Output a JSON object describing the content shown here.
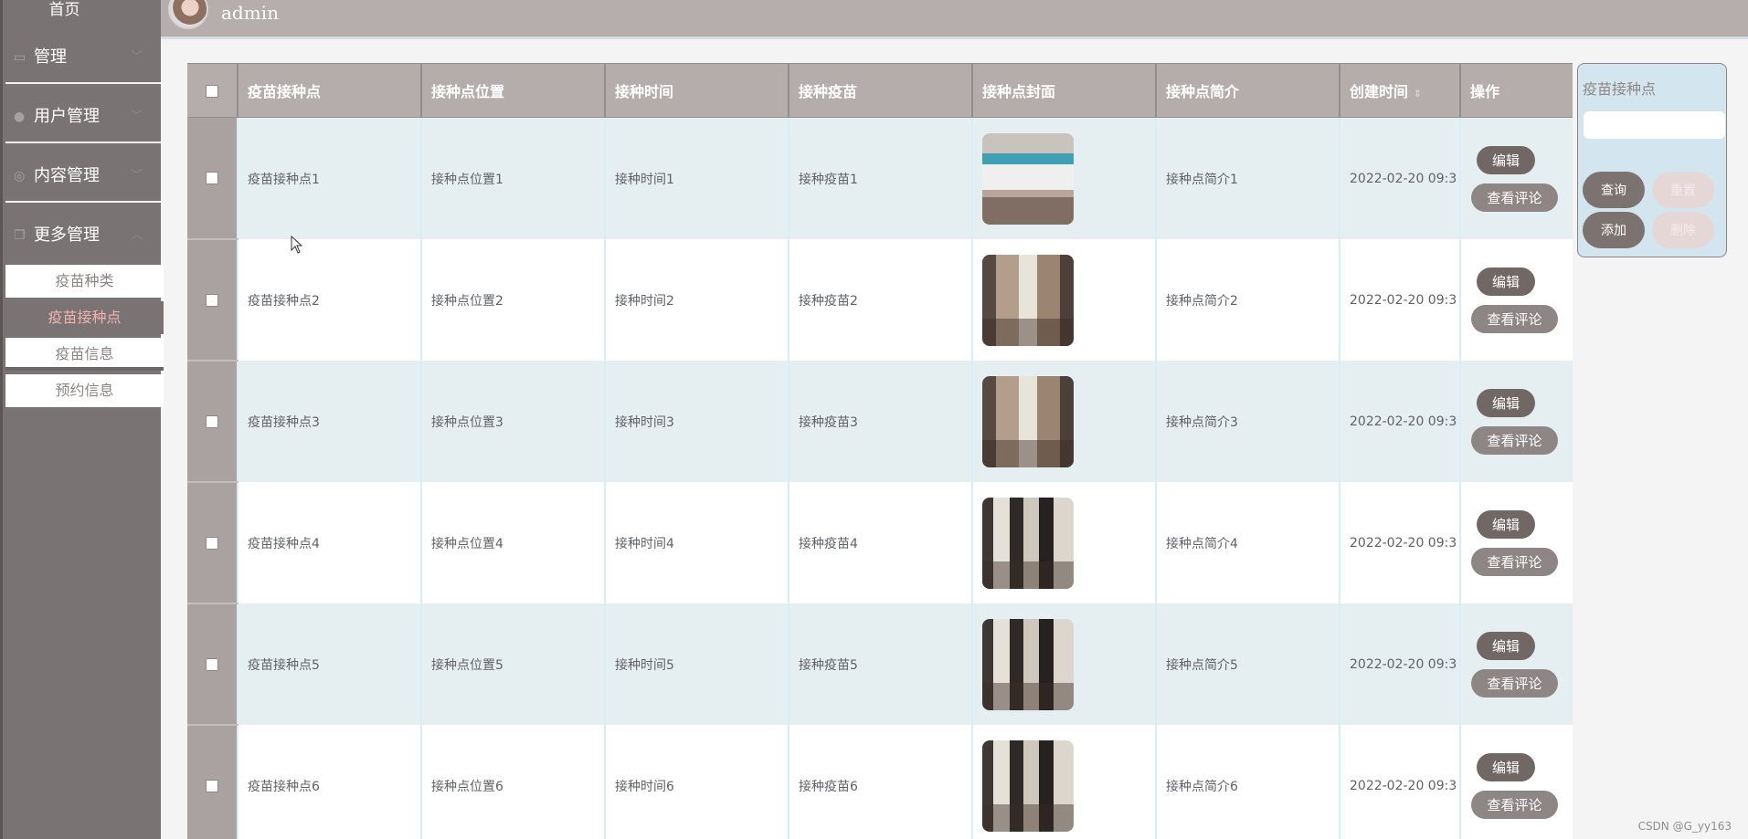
{
  "sidebar": {
    "home": "首页",
    "overlap_label": "管理",
    "menus": [
      {
        "icon": "message-icon",
        "label": "管理",
        "arrow": "﹀"
      },
      {
        "icon": "user-icon",
        "label": "用户管理",
        "arrow": "﹀"
      },
      {
        "icon": "content-icon",
        "label": "内容管理",
        "arrow": "﹀"
      },
      {
        "icon": "more-icon",
        "label": "更多管理",
        "arrow": "︿"
      }
    ],
    "sub_items": [
      "疫苗种类",
      "疫苗接种点",
      "疫苗信息",
      "预约信息"
    ],
    "active_sub": "疫苗接种点"
  },
  "topbar": {
    "username": "admin"
  },
  "table": {
    "headers": [
      "疫苗接种点",
      "接种点位置",
      "接种时间",
      "接种疫苗",
      "接种点封面",
      "接种点简介",
      "创建时间",
      "操作"
    ],
    "sort_icon": "⇕",
    "rows": [
      {
        "name": "疫苗接种点1",
        "location": "接种点位置1",
        "time": "接种时间1",
        "vaccine": "接种疫苗1",
        "intro": "接种点简介1",
        "created": "2022-02-20 09:3"
      },
      {
        "name": "疫苗接种点2",
        "location": "接种点位置2",
        "time": "接种时间2",
        "vaccine": "接种疫苗2",
        "intro": "接种点简介2",
        "created": "2022-02-20 09:3"
      },
      {
        "name": "疫苗接种点3",
        "location": "接种点位置3",
        "time": "接种时间3",
        "vaccine": "接种疫苗3",
        "intro": "接种点简介3",
        "created": "2022-02-20 09:3"
      },
      {
        "name": "疫苗接种点4",
        "location": "接种点位置4",
        "time": "接种时间4",
        "vaccine": "接种疫苗4",
        "intro": "接种点简介4",
        "created": "2022-02-20 09:3"
      },
      {
        "name": "疫苗接种点5",
        "location": "接种点位置5",
        "time": "接种时间5",
        "vaccine": "接种疫苗5",
        "intro": "接种点简介5",
        "created": "2022-02-20 09:3"
      },
      {
        "name": "疫苗接种点6",
        "location": "接种点位置6",
        "time": "接种时间6",
        "vaccine": "接种疫苗6",
        "intro": "接种点简介6",
        "created": "2022-02-20 09:3"
      }
    ],
    "edit_label": "编辑",
    "comment_label": "查看评论"
  },
  "search": {
    "label": "疫苗接种点",
    "query": "查询",
    "reset": "重置",
    "add": "添加",
    "delete": "删除"
  },
  "watermark": "CSDN @G_yy163",
  "colors": {
    "sidebar": "#7a7373",
    "header": "#b5adab",
    "active_sub": "#f3b1b1",
    "row_stripe": "#e5eff2",
    "button": "#7c7371"
  }
}
